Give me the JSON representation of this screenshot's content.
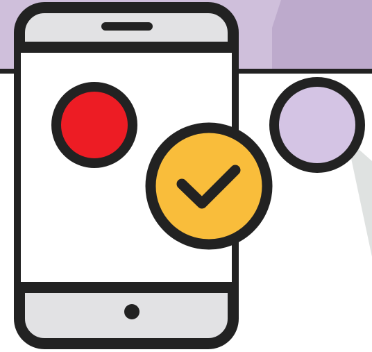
{
  "illustration": {
    "subject": "mobile-phone-with-checkmark",
    "icons": [
      "phone-icon",
      "checkmark-icon"
    ],
    "colors": {
      "banner": "#cfbfdb",
      "banner_shape": "#b7a3c7",
      "outline": "#222222",
      "phone_bezel": "#e2e2e4",
      "phone_screen": "#ffffff",
      "red_dot": "#ed1c24",
      "check_badge": "#f9bd3b",
      "purple_dot": "#d4c4e4",
      "diagonal_line": "#dfe2e1"
    }
  }
}
